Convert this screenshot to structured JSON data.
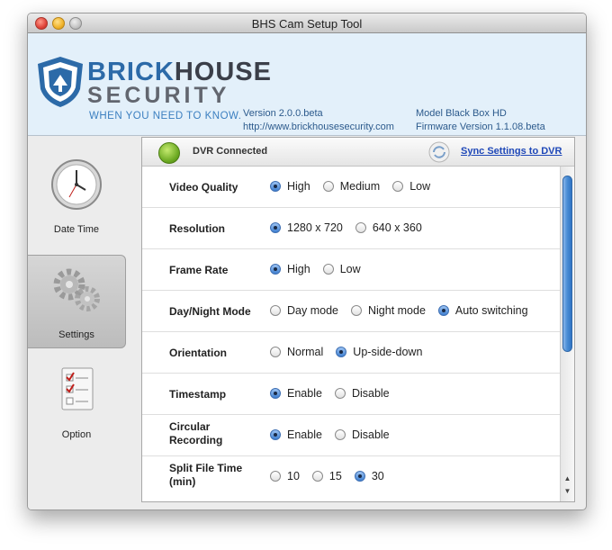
{
  "window": {
    "title": "BHS Cam Setup Tool"
  },
  "header": {
    "brand_line1_a": "BRICK",
    "brand_line1_b": "HOUSE",
    "brand_line2": "SECURITY",
    "tagline": "WHEN YOU NEED TO KNOW.",
    "version": "Version 2.0.0.beta",
    "url": "http://www.brickhousesecurity.com",
    "model": "Model Black Box HD",
    "firmware": "Firmware Version 1.1.08.beta"
  },
  "sidebar": {
    "items": [
      {
        "label": "Date Time",
        "icon": "clock-icon",
        "active": false
      },
      {
        "label": "Settings",
        "icon": "gears-icon",
        "active": true
      },
      {
        "label": "Option",
        "icon": "checklist-icon",
        "active": false
      }
    ]
  },
  "status": {
    "text": "DVR Connected",
    "sync_label": "Sync Settings to DVR",
    "status_color": "#6aa821"
  },
  "settings": [
    {
      "label": "Video Quality",
      "options": [
        "High",
        "Medium",
        "Low"
      ],
      "selected": 0
    },
    {
      "label": "Resolution",
      "options": [
        "1280 x 720",
        "640 x 360"
      ],
      "selected": 0
    },
    {
      "label": "Frame Rate",
      "options": [
        "High",
        "Low"
      ],
      "selected": 0
    },
    {
      "label": "Day/Night Mode",
      "options": [
        "Day mode",
        "Night mode",
        "Auto switching"
      ],
      "selected": 2
    },
    {
      "label": "Orientation",
      "options": [
        "Normal",
        "Up-side-down"
      ],
      "selected": 1
    },
    {
      "label": "Timestamp",
      "options": [
        "Enable",
        "Disable"
      ],
      "selected": 0
    },
    {
      "label": "Circular Recording",
      "options": [
        "Enable",
        "Disable"
      ],
      "selected": 0
    },
    {
      "label": "Split File Time (min)",
      "options": [
        "10",
        "15",
        "30"
      ],
      "selected": 2
    }
  ],
  "colors": {
    "accent": "#2c6aa8",
    "link": "#1f48b8",
    "header_bg": "#e3f0fa"
  }
}
